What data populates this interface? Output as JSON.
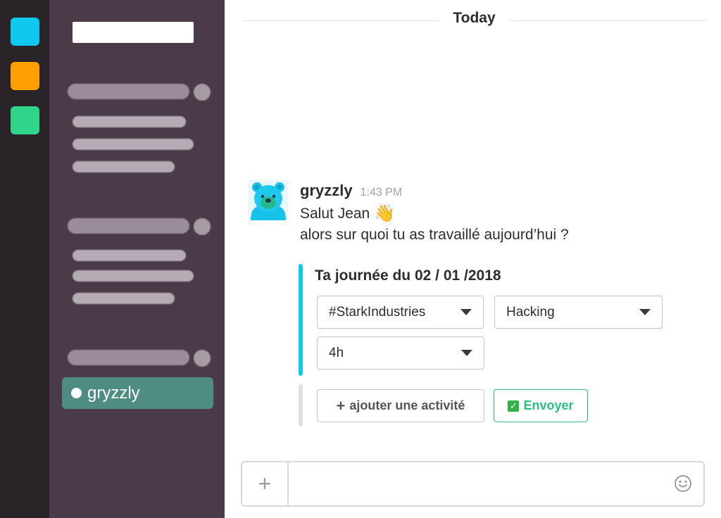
{
  "rail": {
    "workspaces": [
      {
        "color": "#0fc8ef"
      },
      {
        "color": "#ff9f00"
      },
      {
        "color": "#2fd58b"
      }
    ]
  },
  "sidebar": {
    "active_channel": {
      "label": "gryzzly",
      "presence": "online"
    }
  },
  "main": {
    "day_divider": "Today",
    "message": {
      "author": "gryzzly",
      "time": "1:43 PM",
      "line1": "Salut Jean",
      "line1_emoji": "👋",
      "line2": "alors sur quoi tu as travaillé aujourd’hui ?"
    },
    "attachment": {
      "title": "Ta journée du 02 / 01 /2018",
      "selects": {
        "project": "#StarkIndustries",
        "activity": "Hacking",
        "duration": "4h"
      },
      "buttons": {
        "add_label": "ajouter une activité",
        "add_icon": "+",
        "send_label": "Envoyer",
        "send_icon": "✓"
      },
      "colors": {
        "accent": "#0fc8ef",
        "send": "#2bbf80"
      }
    },
    "composer": {
      "plus_icon": "+"
    }
  }
}
